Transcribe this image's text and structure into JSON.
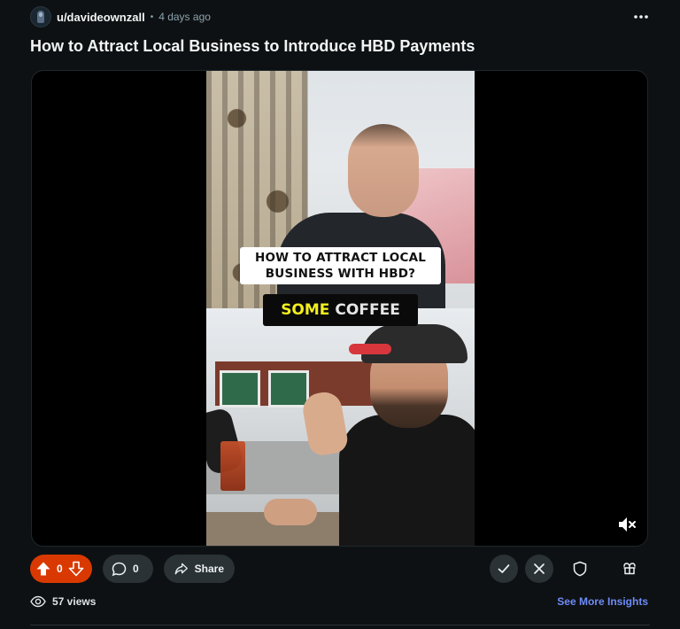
{
  "post": {
    "author": "u/davideownzall",
    "separator": "•",
    "time": "4 days ago",
    "title": "How to Attract Local Business to Introduce HBD Payments"
  },
  "video": {
    "caption_line1": "HOW TO ATTRACT LOCAL",
    "caption_line2": "BUSINESS WITH HBD?",
    "caption_highlight": "SOME",
    "caption_rest": "COFFEE",
    "muted": true
  },
  "actions": {
    "vote_count": "0",
    "comment_count": "0",
    "share_label": "Share"
  },
  "footer": {
    "views": "57 views",
    "insights_link": "See More Insights"
  },
  "colors": {
    "background": "#0e1113",
    "upvote_active": "#d93900",
    "link": "#6e8cf8",
    "caption_highlight": "#f2ee1f"
  },
  "icons": [
    "avatar",
    "overflow-menu-icon",
    "volume-mute-icon",
    "upvote-icon",
    "downvote-icon",
    "comment-icon",
    "share-icon",
    "approve-icon",
    "remove-icon",
    "shield-icon",
    "award-icon",
    "views-icon"
  ]
}
